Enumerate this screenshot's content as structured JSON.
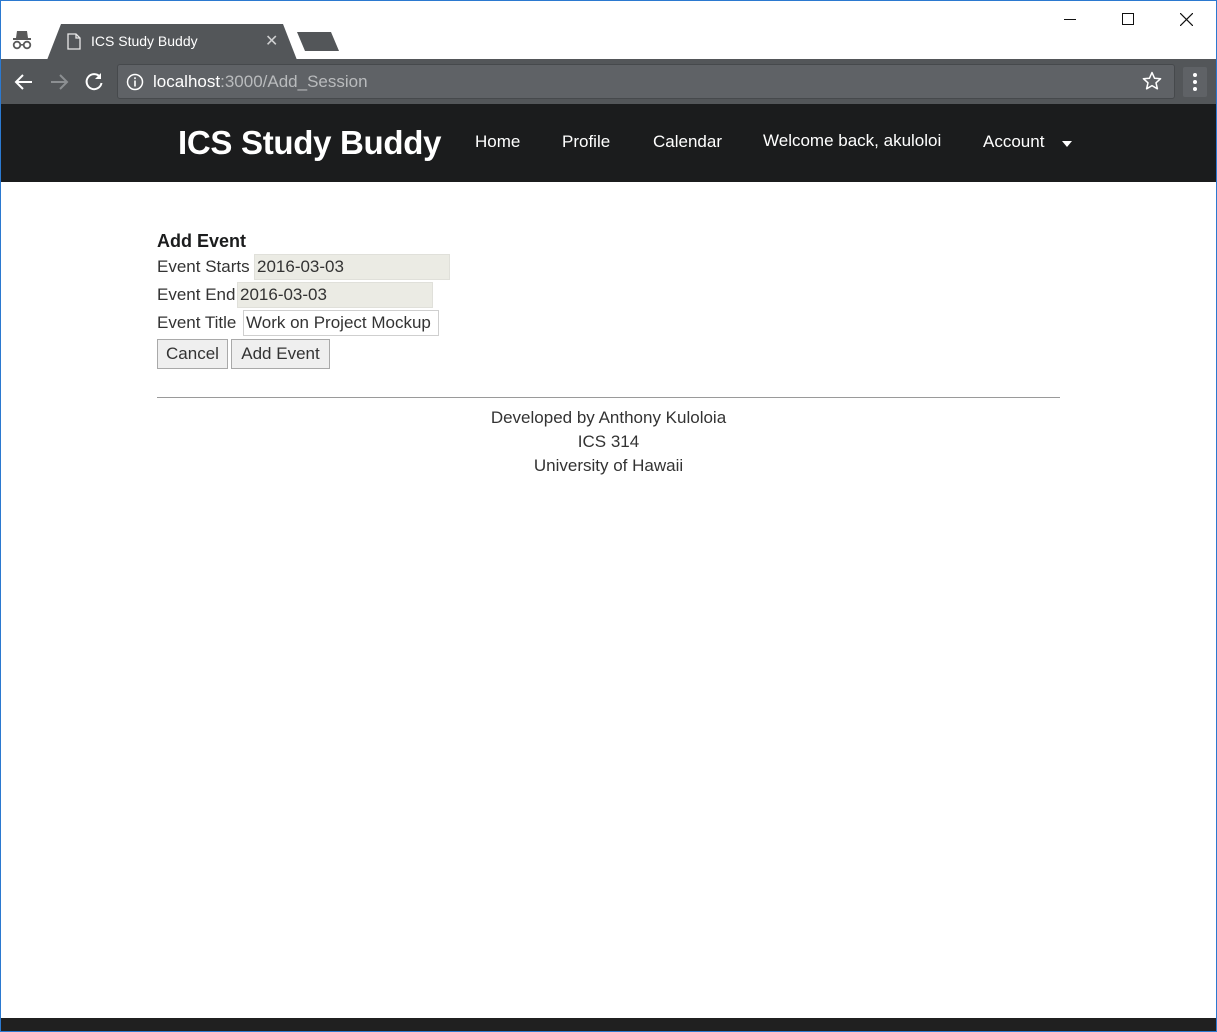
{
  "browser": {
    "tab_title": "ICS Study Buddy",
    "url_host": "localhost",
    "url_rest": ":3000/Add_Session"
  },
  "navbar": {
    "brand": "ICS Study Buddy",
    "items": [
      {
        "label": "Home"
      },
      {
        "label": "Profile"
      },
      {
        "label": "Calendar"
      }
    ],
    "welcome": "Welcome back, akuloloi",
    "account_label": "Account"
  },
  "form": {
    "title": "Add Event",
    "starts_label": "Event Starts",
    "starts_value": "2016-03-03",
    "end_label": "Event End",
    "end_value": "2016-03-03",
    "title_label": "Event Title",
    "title_value": "Work on Project Mockup",
    "cancel_label": "Cancel",
    "submit_label": "Add Event"
  },
  "footer": {
    "line1": "Developed by Anthony Kuloloia",
    "line2": "ICS 314",
    "line3": "University of Hawaii"
  },
  "icons": {
    "incognito": "incognito-icon",
    "page": "page-icon",
    "close": "close-icon",
    "back": "back-arrow-icon",
    "forward": "forward-arrow-icon",
    "reload": "reload-icon",
    "info": "info-icon",
    "star": "star-icon",
    "menu": "menu-dots-icon",
    "caret": "caret-down-icon"
  },
  "colors": {
    "navbar_bg": "#1b1c1d",
    "toolbar_bg": "#535659",
    "date_field_bg": "#ebebe4"
  }
}
